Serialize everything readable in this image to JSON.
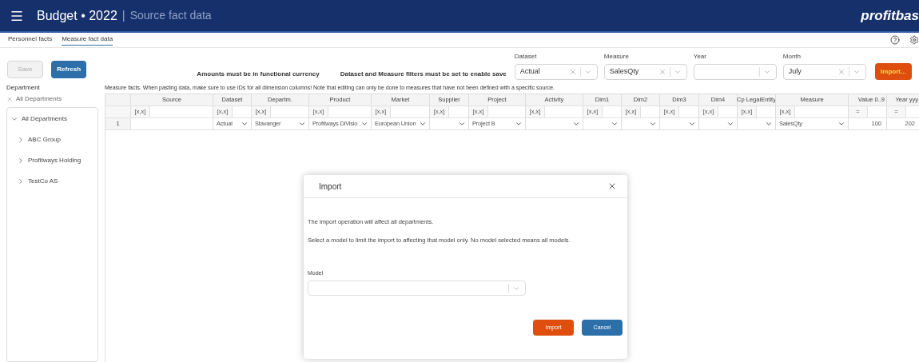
{
  "header": {
    "title": "Budget • 2022",
    "separator": "|",
    "subtitle": "Source fact data",
    "logo": "profitbas"
  },
  "tabs": [
    {
      "label": "Personnel facts",
      "selected": false
    },
    {
      "label": "Measure fact data",
      "selected": true
    }
  ],
  "toolbar": {
    "buttons": [
      {
        "label": "Save",
        "kind": "secondary",
        "disabled": true
      },
      {
        "label": "Refresh",
        "kind": "primary",
        "disabled": false
      }
    ],
    "notes": [
      "Amounts must be in functional currency",
      "Dataset and Measure filters must be set to enable save"
    ],
    "filters": [
      {
        "label": "Dataset",
        "value": "Actual",
        "clearable": true
      },
      {
        "label": "Measure",
        "value": "SalesQty",
        "clearable": true
      },
      {
        "label": "Year",
        "clearable": false
      },
      {
        "label": "Month",
        "value": "July",
        "clearable": true
      }
    ],
    "import_button": "Import..."
  },
  "sidebar": {
    "title": "Department",
    "clear_label": "All Departments",
    "tree": [
      {
        "label": "All Departments",
        "expanded": true,
        "children": [
          {
            "label": "ABC Group",
            "expanded": false
          },
          {
            "label": "Profitways Holding",
            "expanded": false
          },
          {
            "label": "TestCo AS",
            "expanded": false
          }
        ]
      }
    ]
  },
  "grid": {
    "caption": "Measure facts. When pasting data, make sure to use IDs for all dimension columns! Note that editing can only be done to measures that have not been defined with a specific source.",
    "columns": [
      {
        "name": "Source",
        "filter_symbol": "[x,x]"
      },
      {
        "name": "Dataset",
        "filter_symbol": "[x,x]"
      },
      {
        "name": "Departm.",
        "filter_symbol": "[x,x]"
      },
      {
        "name": "Product",
        "filter_symbol": "[x,x]"
      },
      {
        "name": "Market",
        "filter_symbol": "[x,x]"
      },
      {
        "name": "Supplier",
        "filter_symbol": "[x,x]"
      },
      {
        "name": "Project",
        "filter_symbol": "[x,x]"
      },
      {
        "name": "Activity",
        "filter_symbol": "[x,x]"
      },
      {
        "name": "Dim1",
        "filter_symbol": "[x,x]"
      },
      {
        "name": "Dim2",
        "filter_symbol": "[x,x]"
      },
      {
        "name": "Dim3",
        "filter_symbol": "[x,x]"
      },
      {
        "name": "Dim4",
        "filter_symbol": "[x,x]"
      },
      {
        "name": "Cp LegalEntity",
        "filter_symbol": "[x,x]"
      },
      {
        "name": "Measure",
        "filter_symbol": "[x,x]"
      },
      {
        "name": "Value 0..9",
        "filter_symbol": "="
      },
      {
        "name": "Year yyy",
        "filter_symbol": "="
      }
    ],
    "rows": [
      {
        "number": "1",
        "cells": [
          {
            "kind": "text"
          },
          {
            "kind": "select",
            "value": "Actual"
          },
          {
            "kind": "select",
            "value": "Stavanger"
          },
          {
            "kind": "select",
            "value": "Profitways DiVisio"
          },
          {
            "kind": "select",
            "value": "European Union"
          },
          {
            "kind": "select"
          },
          {
            "kind": "select",
            "value": "Project B"
          },
          {
            "kind": "select"
          },
          {
            "kind": "select"
          },
          {
            "kind": "select"
          },
          {
            "kind": "select"
          },
          {
            "kind": "select"
          },
          {
            "kind": "select"
          },
          {
            "kind": "select",
            "value": "SalesQty"
          },
          {
            "kind": "number",
            "value": "100"
          },
          {
            "kind": "number",
            "value": "202"
          }
        ]
      }
    ]
  },
  "dialog": {
    "title": "Import",
    "paragraphs": [
      "The import operation will affect all departments.",
      "Select a model to limit the import to affecting that model only. No model selected means all models."
    ],
    "field_label": "Model",
    "buttons": [
      {
        "label": "Import",
        "kind": "primary"
      },
      {
        "label": "Cancel",
        "kind": "secondary"
      }
    ]
  }
}
